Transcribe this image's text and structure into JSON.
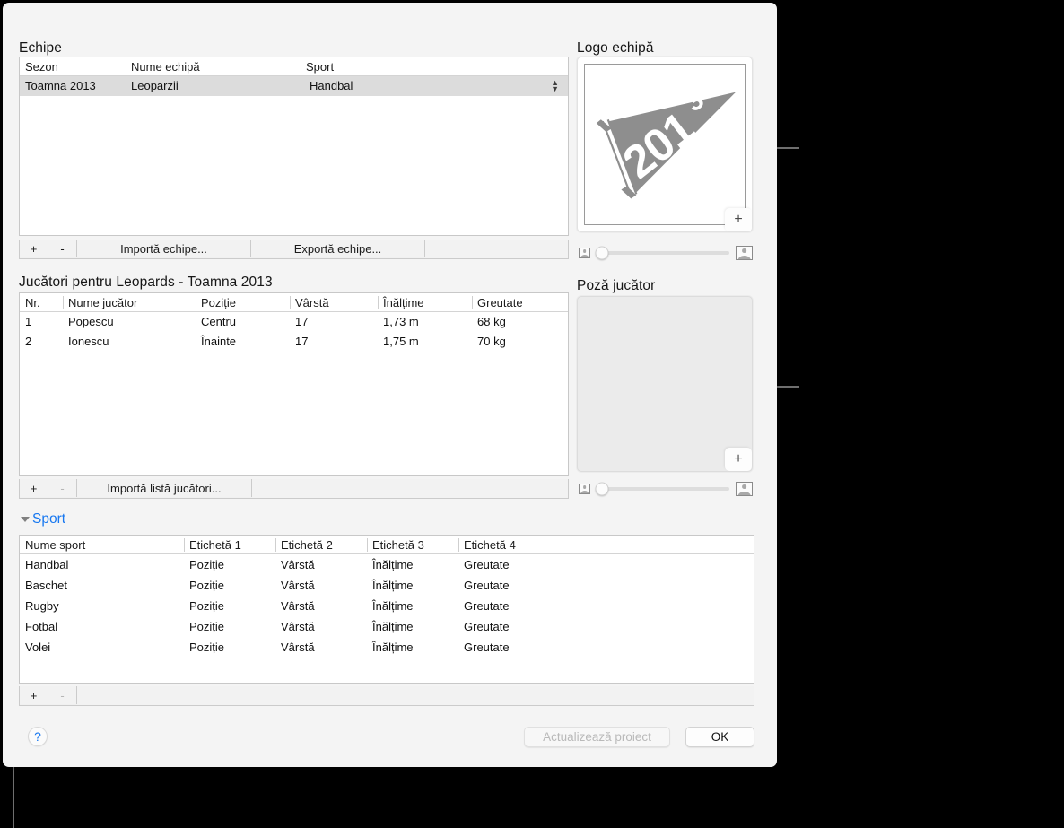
{
  "window": {
    "teams_section": {
      "label": "Echipe",
      "columns": [
        "Sezon",
        "Nume echipă",
        "Sport"
      ],
      "rows": [
        {
          "sezon": "Toamna 2013",
          "nume": "Leoparzii",
          "sport": "Handbal",
          "selected": true
        }
      ],
      "toolbar": {
        "add": "+",
        "remove": "-",
        "import": "Importă echipe...",
        "export": "Exportă echipe..."
      }
    },
    "players_section": {
      "label": "Jucători pentru Leopards - Toamna 2013",
      "columns": [
        "Nr.",
        "Nume jucător",
        "Poziție",
        "Vârstă",
        "Înălțime",
        "Greutate"
      ],
      "rows": [
        {
          "nr": "1",
          "nume": "Popescu",
          "pozitie": "Centru",
          "varsta": "17",
          "inaltime": "1,73 m",
          "greutate": "68 kg"
        },
        {
          "nr": "2",
          "nume": "Ionescu",
          "pozitie": "Înainte",
          "varsta": "17",
          "inaltime": "1,75 m",
          "greutate": "70 kg"
        }
      ],
      "toolbar": {
        "add": "+",
        "remove": "-",
        "import": "Importă listă jucători..."
      }
    },
    "sport_section": {
      "label": "Sport",
      "expanded": true,
      "columns": [
        "Nume sport",
        "Etichetă 1",
        "Etichetă 2",
        "Etichetă 3",
        "Etichetă 4"
      ],
      "rows": [
        {
          "nume": "Handbal",
          "e1": "Poziție",
          "e2": "Vârstă",
          "e3": "Înălțime",
          "e4": "Greutate"
        },
        {
          "nume": "Baschet",
          "e1": "Poziție",
          "e2": "Vârstă",
          "e3": "Înălțime",
          "e4": "Greutate"
        },
        {
          "nume": "Rugby",
          "e1": "Poziție",
          "e2": "Vârstă",
          "e3": "Înălțime",
          "e4": "Greutate"
        },
        {
          "nume": "Fotbal",
          "e1": "Poziție",
          "e2": "Vârstă",
          "e3": "Înălțime",
          "e4": "Greutate"
        },
        {
          "nume": "Volei",
          "e1": "Poziție",
          "e2": "Vârstă",
          "e3": "Înălțime",
          "e4": "Greutate"
        }
      ],
      "toolbar": {
        "add": "+",
        "remove": "-"
      }
    },
    "logo_panel": {
      "label": "Logo echipă",
      "add_button": "+",
      "image_alt": "2013"
    },
    "photo_panel": {
      "label": "Poză jucător",
      "add_button": "+"
    },
    "footer": {
      "help": "?",
      "update_button": "Actualizează proiect",
      "update_enabled": false,
      "ok_button": "OK"
    }
  },
  "colors": {
    "accent_blue": "#1878f0",
    "selection_gray": "#dcdcdc",
    "window_bg": "#f4f4f4",
    "backdrop": "#000000",
    "logo_gray": "#8e8e8e"
  }
}
